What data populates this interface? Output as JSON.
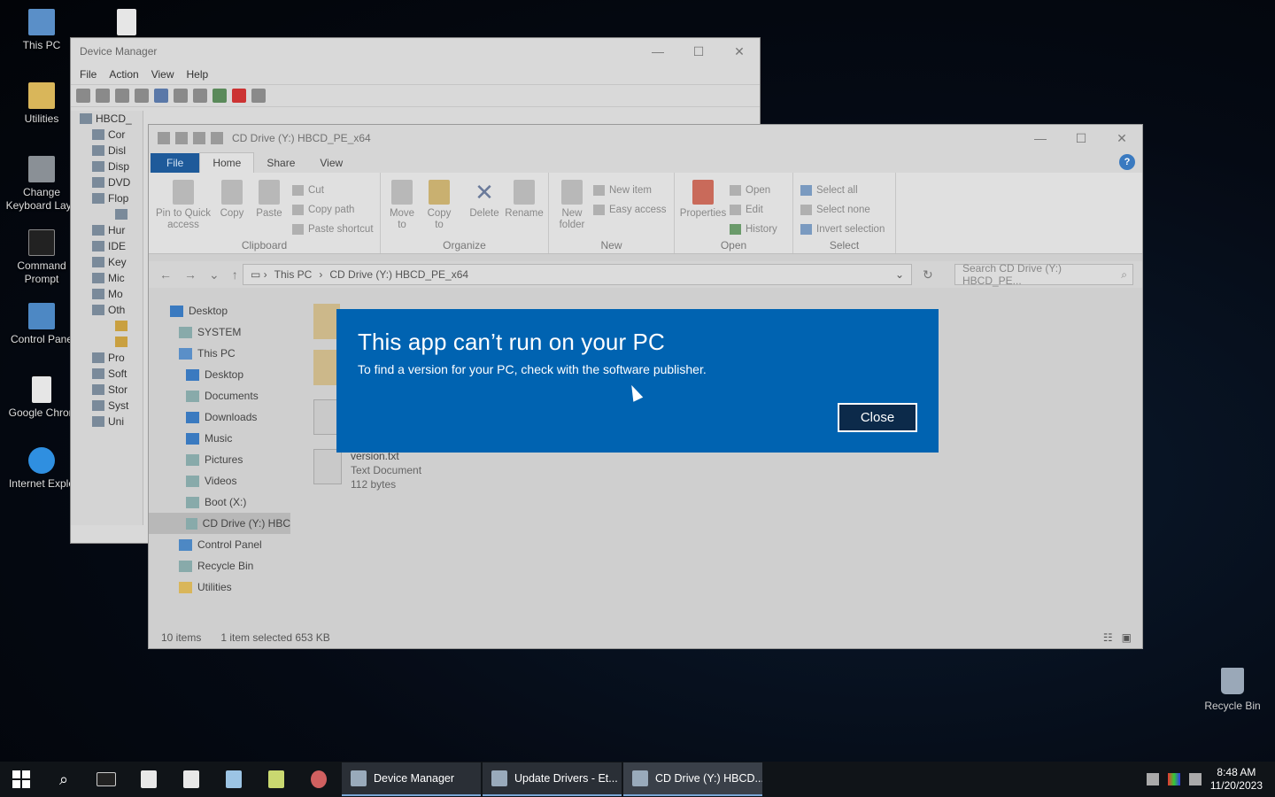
{
  "desktop": {
    "icons": [
      {
        "label": "This PC"
      },
      {
        "label": ""
      },
      {
        "label": "Utilities"
      },
      {
        "label": "Change Keyboard Layo"
      },
      {
        "label": "Command Prompt"
      },
      {
        "label": "Control Pane"
      },
      {
        "label": "Google Chron"
      },
      {
        "label": "Internet Explo"
      }
    ],
    "recycle_bin": "Recycle Bin"
  },
  "device_manager": {
    "title": "Device Manager",
    "menu": [
      "File",
      "Action",
      "View",
      "Help"
    ],
    "tree": [
      "HBCD_",
      "Cor",
      "Disl",
      "Disp",
      "DVD",
      "Flop",
      "",
      "Hur",
      "IDE",
      "Key",
      "Mic",
      "Mo",
      "Oth",
      "",
      "",
      "Pro",
      "Soft",
      "Stor",
      "Syst",
      "Uni"
    ]
  },
  "explorer": {
    "title": "CD Drive (Y:) HBCD_PE_x64",
    "tabs": {
      "file": "File",
      "home": "Home",
      "share": "Share",
      "view": "View",
      "help": "?"
    },
    "ribbon": {
      "clipboard": {
        "label": "Clipboard",
        "pin": "Pin to Quick access",
        "copy": "Copy",
        "paste": "Paste",
        "cut": "Cut",
        "copy_path": "Copy path",
        "paste_shortcut": "Paste shortcut"
      },
      "organize": {
        "label": "Organize",
        "move_to": "Move to",
        "copy_to": "Copy to",
        "delete": "Delete",
        "rename": "Rename"
      },
      "new": {
        "label": "New",
        "new_folder": "New folder",
        "new_item": "New item",
        "easy_access": "Easy access"
      },
      "open": {
        "label": "Open",
        "properties": "Properties",
        "open": "Open",
        "edit": "Edit",
        "history": "History"
      },
      "select": {
        "label": "Select",
        "select_all": "Select all",
        "select_none": "Select none",
        "invert": "Invert selection"
      }
    },
    "address": {
      "this_pc": "This PC",
      "current": "CD Drive (Y:) HBCD_PE_x64",
      "search_placeholder": "Search CD Drive (Y:) HBCD_PE..."
    },
    "nav": [
      "Desktop",
      "SYSTEM",
      "This PC",
      "Desktop",
      "Documents",
      "Downloads",
      "Music",
      "Pictures",
      "Videos",
      "Boot (X:)",
      "CD Drive (Y:) HBC",
      "Control Panel",
      "Recycle Bin",
      "Utilities"
    ],
    "file": {
      "name": "version.txt",
      "type": "Text Document",
      "size": "112 bytes"
    },
    "status": {
      "count": "10 items",
      "selected": "1 item selected  653 KB"
    }
  },
  "dialog": {
    "title": "This app can’t run on your PC",
    "message": "To find a version for your PC, check with the software publisher.",
    "close": "Close"
  },
  "taskbar": {
    "apps": [
      {
        "label": "Device Manager"
      },
      {
        "label": "Update Drivers - Et..."
      },
      {
        "label": "CD Drive (Y:) HBCD..."
      }
    ],
    "time": "8:48 AM",
    "date": "11/20/2023"
  }
}
